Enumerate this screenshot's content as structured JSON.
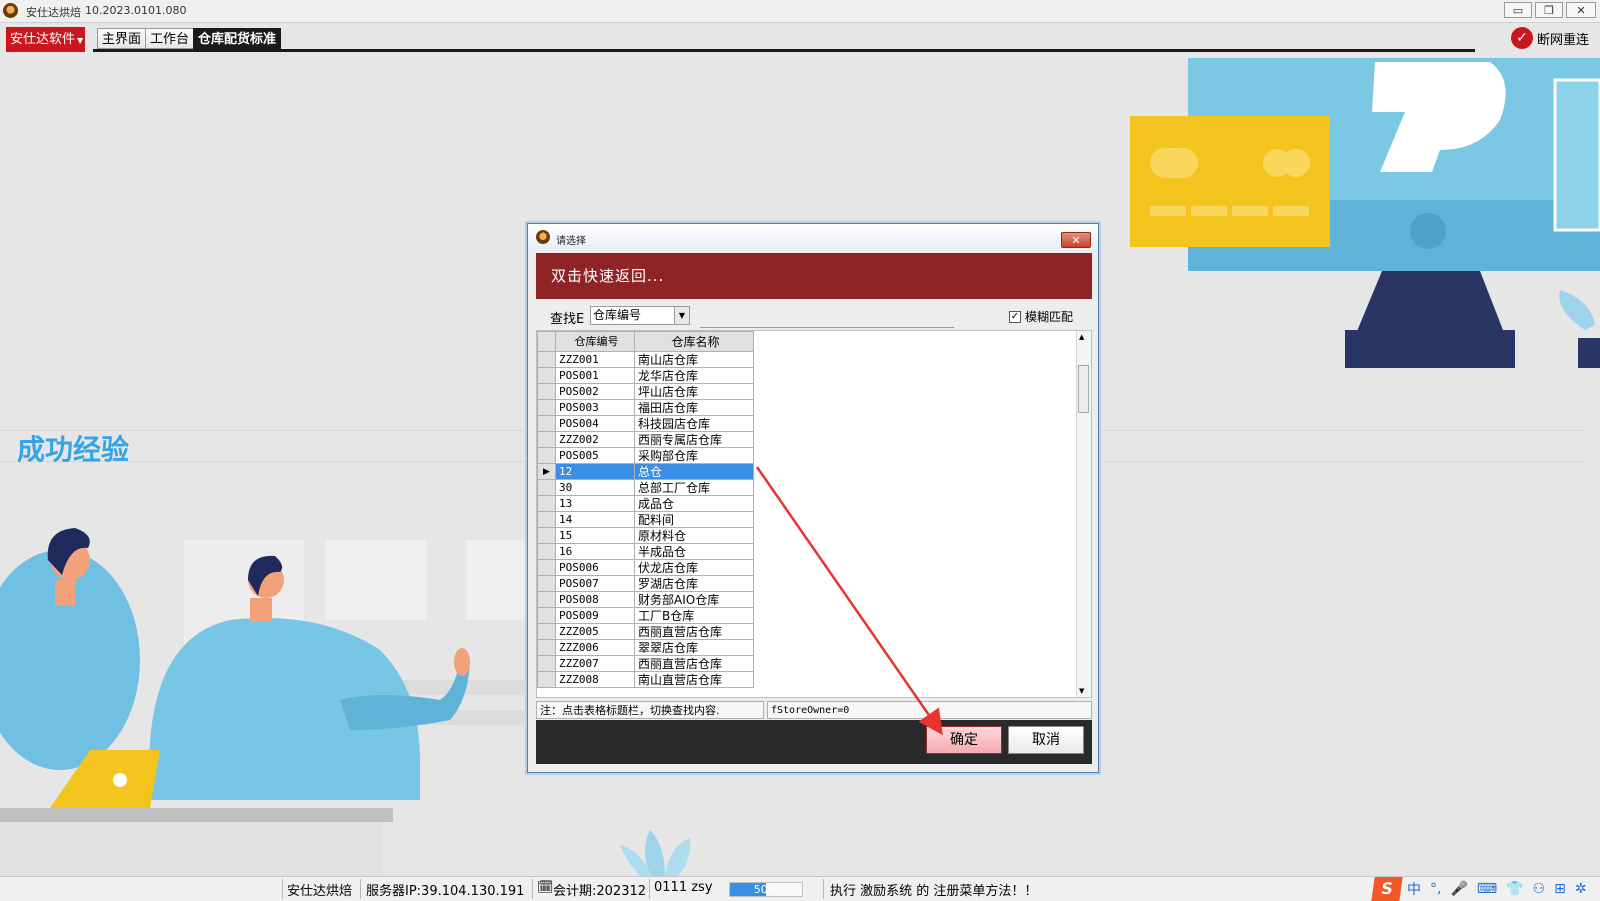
{
  "window": {
    "title": "安仕达烘焙",
    "version": "10.2023.0101.080",
    "controls": [
      "▭",
      "❐",
      "✕"
    ]
  },
  "menu": {
    "brand_label": "安仕达软件",
    "tabs": [
      "主界面",
      "工作台",
      "仓库配货标准"
    ],
    "active_tab": "仓库配货标准",
    "reconnect_label": "断网重连"
  },
  "background": {
    "headline": "成功经验"
  },
  "dialog": {
    "title": "请选择",
    "banner": "双击快速返回...",
    "search_label": "查找E",
    "search_field": "仓库编号",
    "search_value": "",
    "fuzzy_label": "模糊匹配",
    "fuzzy_checked": true,
    "columns": [
      "仓库编号",
      "仓库名称"
    ],
    "rows": [
      [
        "ZZZ001",
        "南山店仓库"
      ],
      [
        "POS001",
        "龙华店仓库"
      ],
      [
        "POS002",
        "坪山店仓库"
      ],
      [
        "POS003",
        "福田店仓库"
      ],
      [
        "POS004",
        "科技园店仓库"
      ],
      [
        "ZZZ002",
        "西丽专属店仓库"
      ],
      [
        "POS005",
        "采购部仓库"
      ],
      [
        "12",
        "总仓"
      ],
      [
        "30",
        "总部工厂仓库"
      ],
      [
        "13",
        "成品仓"
      ],
      [
        "14",
        "配料间"
      ],
      [
        "15",
        "原材料仓"
      ],
      [
        "16",
        "半成品仓"
      ],
      [
        "POS006",
        "伏龙店仓库"
      ],
      [
        "POS007",
        "罗湖店仓库"
      ],
      [
        "POS008",
        "财务部AIO仓库"
      ],
      [
        "POS009",
        "工厂B仓库"
      ],
      [
        "ZZZ005",
        "西丽直营店仓库"
      ],
      [
        "ZZZ006",
        "翠翠店仓库"
      ],
      [
        "ZZZ007",
        "西丽直营店仓库"
      ],
      [
        "ZZZ008",
        "南山直营店仓库"
      ]
    ],
    "selected_row": 7,
    "note": "注：点击表格标题栏，切换查找内容.",
    "filter": "fStoreOwner=0",
    "ok_label": "确定",
    "cancel_label": "取消"
  },
  "statusbar": {
    "company": "安仕达烘焙",
    "server": "服务器IP:39.104.130.191",
    "period": "会计期:202312",
    "user": "0111 zsy",
    "progress_percent": 50,
    "progress_label": "50%",
    "message": "执行 激励系统 的 注册菜单方法！！"
  },
  "tray": {
    "ime_label": "S",
    "items": [
      "中",
      "°,",
      "🎤",
      "⌨",
      "👕",
      "⚇",
      "⊞",
      "✲"
    ]
  },
  "colors": {
    "brand_red": "#c8171d",
    "banner_red": "#8f2427",
    "selection_blue": "#3a8ee6",
    "headline_blue": "#36a3e6",
    "annotation_arrow": "#e8342e"
  }
}
